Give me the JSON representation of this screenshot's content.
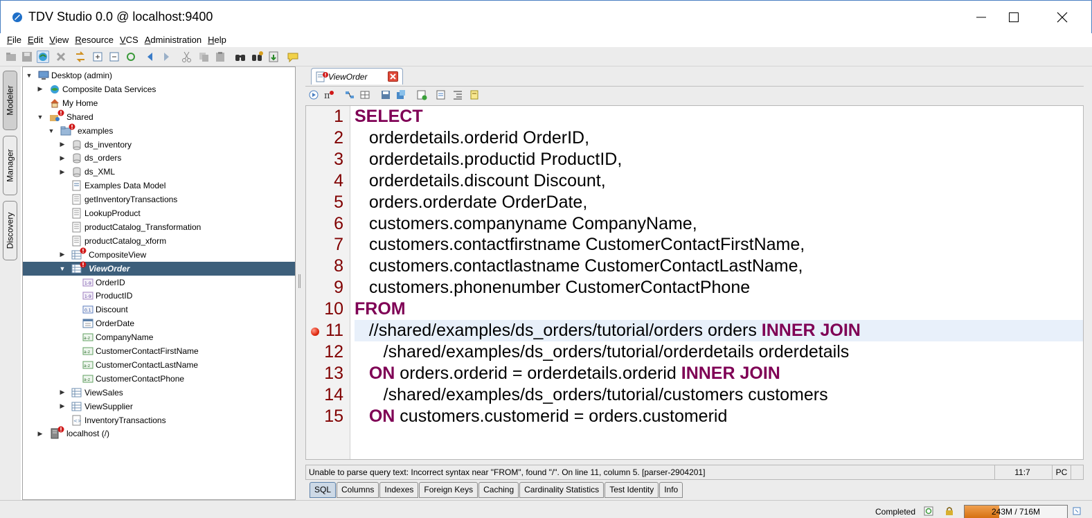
{
  "window": {
    "title": "TDV Studio 0.0 @ localhost:9400"
  },
  "menu": [
    "File",
    "Edit",
    "View",
    "Resource",
    "VCS",
    "Administration",
    "Help"
  ],
  "side_tabs": [
    "Modeler",
    "Manager",
    "Discovery"
  ],
  "tree": [
    {
      "label": "Desktop (admin)",
      "indent": 0,
      "arrow": "▼",
      "icon": "desktop-icon",
      "error": false
    },
    {
      "label": "Composite Data Services",
      "indent": 1,
      "arrow": "▶",
      "icon": "globe-icon",
      "error": false
    },
    {
      "label": "My Home",
      "indent": 1,
      "arrow": "",
      "icon": "home-icon",
      "error": false
    },
    {
      "label": "Shared",
      "indent": 1,
      "arrow": "▼",
      "icon": "shared-folder-icon",
      "error": true
    },
    {
      "label": "examples",
      "indent": 2,
      "arrow": "▼",
      "icon": "folder-icon",
      "error": true
    },
    {
      "label": "ds_inventory",
      "indent": 3,
      "arrow": "▶",
      "icon": "datasource-icon",
      "error": false
    },
    {
      "label": "ds_orders",
      "indent": 3,
      "arrow": "▶",
      "icon": "datasource-icon",
      "error": false
    },
    {
      "label": "ds_XML",
      "indent": 3,
      "arrow": "▶",
      "icon": "datasource-icon",
      "error": false
    },
    {
      "label": "Examples Data Model",
      "indent": 3,
      "arrow": "",
      "icon": "model-icon",
      "error": false
    },
    {
      "label": "getInventoryTransactions",
      "indent": 3,
      "arrow": "",
      "icon": "procedure-icon",
      "error": false
    },
    {
      "label": "LookupProduct",
      "indent": 3,
      "arrow": "",
      "icon": "procedure-icon",
      "error": false
    },
    {
      "label": "productCatalog_Transformation",
      "indent": 3,
      "arrow": "",
      "icon": "procedure-icon",
      "error": false
    },
    {
      "label": "productCatalog_xform",
      "indent": 3,
      "arrow": "",
      "icon": "procedure-icon",
      "error": false
    },
    {
      "label": "CompositeView",
      "indent": 3,
      "arrow": "▶",
      "icon": "view-icon",
      "error": true
    },
    {
      "label": "ViewOrder",
      "indent": 3,
      "arrow": "▼",
      "icon": "view-icon",
      "error": true,
      "selected": true
    },
    {
      "label": "OrderID",
      "indent": 4,
      "arrow": "",
      "icon": "integer-column-icon",
      "error": false
    },
    {
      "label": "ProductID",
      "indent": 4,
      "arrow": "",
      "icon": "integer-column-icon",
      "error": false
    },
    {
      "label": "Discount",
      "indent": 4,
      "arrow": "",
      "icon": "decimal-column-icon",
      "error": false
    },
    {
      "label": "OrderDate",
      "indent": 4,
      "arrow": "",
      "icon": "date-column-icon",
      "error": false
    },
    {
      "label": "CompanyName",
      "indent": 4,
      "arrow": "",
      "icon": "string-column-icon",
      "error": false
    },
    {
      "label": "CustomerContactFirstName",
      "indent": 4,
      "arrow": "",
      "icon": "string-column-icon",
      "error": false
    },
    {
      "label": "CustomerContactLastName",
      "indent": 4,
      "arrow": "",
      "icon": "string-column-icon",
      "error": false
    },
    {
      "label": "CustomerContactPhone",
      "indent": 4,
      "arrow": "",
      "icon": "string-column-icon",
      "error": false
    },
    {
      "label": "ViewSales",
      "indent": 3,
      "arrow": "▶",
      "icon": "view-icon",
      "error": false
    },
    {
      "label": "ViewSupplier",
      "indent": 3,
      "arrow": "▶",
      "icon": "view-icon",
      "error": false
    },
    {
      "label": "InventoryTransactions",
      "indent": 3,
      "arrow": "",
      "icon": "xml-icon",
      "error": false
    },
    {
      "label": "localhost (/)",
      "indent": 1,
      "arrow": "▶",
      "icon": "server-icon",
      "error": true
    }
  ],
  "editor": {
    "tab_label": "ViewOrder",
    "lines": [
      {
        "num": "1",
        "parts": [
          {
            "t": "SELECT",
            "kw": true
          }
        ]
      },
      {
        "num": "2",
        "parts": [
          {
            "t": "   orderdetails.orderid OrderID,",
            "kw": false
          }
        ]
      },
      {
        "num": "3",
        "parts": [
          {
            "t": "   orderdetails.productid ProductID,",
            "kw": false
          }
        ]
      },
      {
        "num": "4",
        "parts": [
          {
            "t": "   orderdetails.discount Discount,",
            "kw": false
          }
        ]
      },
      {
        "num": "5",
        "parts": [
          {
            "t": "   orders.orderdate OrderDate,",
            "kw": false
          }
        ]
      },
      {
        "num": "6",
        "parts": [
          {
            "t": "   customers.companyname CompanyName,",
            "kw": false
          }
        ]
      },
      {
        "num": "7",
        "parts": [
          {
            "t": "   customers.contactfirstname CustomerContactFirstName,",
            "kw": false
          }
        ]
      },
      {
        "num": "8",
        "parts": [
          {
            "t": "   customers.contactlastname CustomerContactLastName,",
            "kw": false
          }
        ]
      },
      {
        "num": "9",
        "parts": [
          {
            "t": "   customers.phonenumber CustomerContactPhone",
            "kw": false
          }
        ]
      },
      {
        "num": "10",
        "parts": [
          {
            "t": "FROM",
            "kw": true
          }
        ]
      },
      {
        "num": "11",
        "breakpoint": true,
        "highlight": true,
        "parts": [
          {
            "t": "   //shared/examples/ds_orders/tutorial/orders orders ",
            "kw": false
          },
          {
            "t": "INNER JOIN",
            "kw": true
          }
        ]
      },
      {
        "num": "12",
        "parts": [
          {
            "t": "      /shared/examples/ds_orders/tutorial/orderdetails orderdetails",
            "kw": false
          }
        ]
      },
      {
        "num": "13",
        "parts": [
          {
            "t": "   ",
            "kw": false
          },
          {
            "t": "ON",
            "kw": true
          },
          {
            "t": " orders.orderid = orderdetails.orderid ",
            "kw": false
          },
          {
            "t": "INNER JOIN",
            "kw": true
          }
        ]
      },
      {
        "num": "14",
        "parts": [
          {
            "t": "      /shared/examples/ds_orders/tutorial/customers customers",
            "kw": false
          }
        ]
      },
      {
        "num": "15",
        "parts": [
          {
            "t": "   ",
            "kw": false
          },
          {
            "t": "ON",
            "kw": true
          },
          {
            "t": " customers.customerid = orders.customerid",
            "kw": false
          }
        ]
      }
    ],
    "status_message": "Unable to parse query text:  Incorrect syntax near \"FROM\", found \"/\".  On line 11, column 5.    [parser-2904201]",
    "cursor_pos": "11:7",
    "mode": "PC"
  },
  "bottom_tabs": [
    "SQL",
    "Columns",
    "Indexes",
    "Foreign Keys",
    "Caching",
    "Cardinality Statistics",
    "Test Identity",
    "Info"
  ],
  "footer": {
    "status": "Completed",
    "memory": "243M / 716M",
    "memory_fraction": 0.34
  },
  "colors": {
    "keyword": "#7f0055",
    "line_number": "#800000",
    "selection": "#3d5f7b"
  }
}
